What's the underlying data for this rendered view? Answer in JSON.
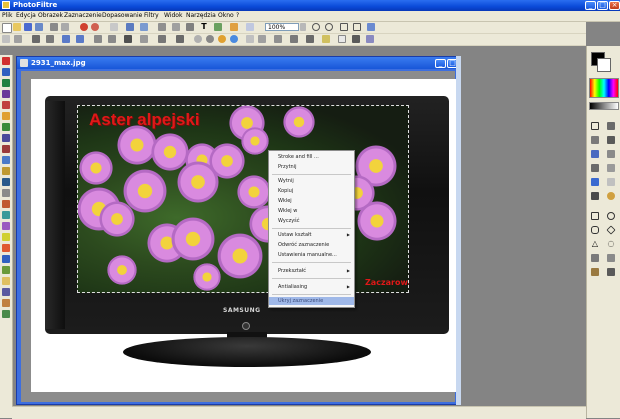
{
  "window": {
    "title": "PhotoFiltre"
  },
  "menubar": [
    "Plik",
    "Edycja",
    "Obrazek",
    "Zaznaczenie",
    "Dopasowanie",
    "Filtry",
    "Widok",
    "Narzędzia",
    "Okno",
    "?"
  ],
  "toolbar": {
    "zoom_value": "100%"
  },
  "document": {
    "title": "2931_max.jpg"
  },
  "image": {
    "title_text": "Aster alpejski",
    "credit_text": "Zaczarowany",
    "brand_text": "SAMSUNG"
  },
  "context_menu": {
    "items": [
      {
        "label": "Stroke and fill ...",
        "submenu": false
      },
      {
        "label": "Przytnij",
        "submenu": false
      },
      {
        "label": "Wytnij",
        "submenu": false
      },
      {
        "label": "Kopiuj",
        "submenu": false
      },
      {
        "label": "Wklej",
        "submenu": false
      },
      {
        "label": "Wklej w",
        "submenu": false
      },
      {
        "label": "Wyczyść",
        "submenu": false
      },
      {
        "label": "Ustaw kształt",
        "submenu": true
      },
      {
        "label": "Odwróć zaznaczenie",
        "submenu": false
      },
      {
        "label": "Ustawienia manualne...",
        "submenu": false
      },
      {
        "label": "Przekształć",
        "submenu": true
      },
      {
        "label": "Antialiasing",
        "submenu": true
      },
      {
        "label": "Ukryj zaznaczenie",
        "submenu": false
      }
    ]
  },
  "colors": {
    "accent": "#0a4ad8",
    "menu_highlight": "#9fb8e8",
    "photo_text": "#e01818"
  }
}
